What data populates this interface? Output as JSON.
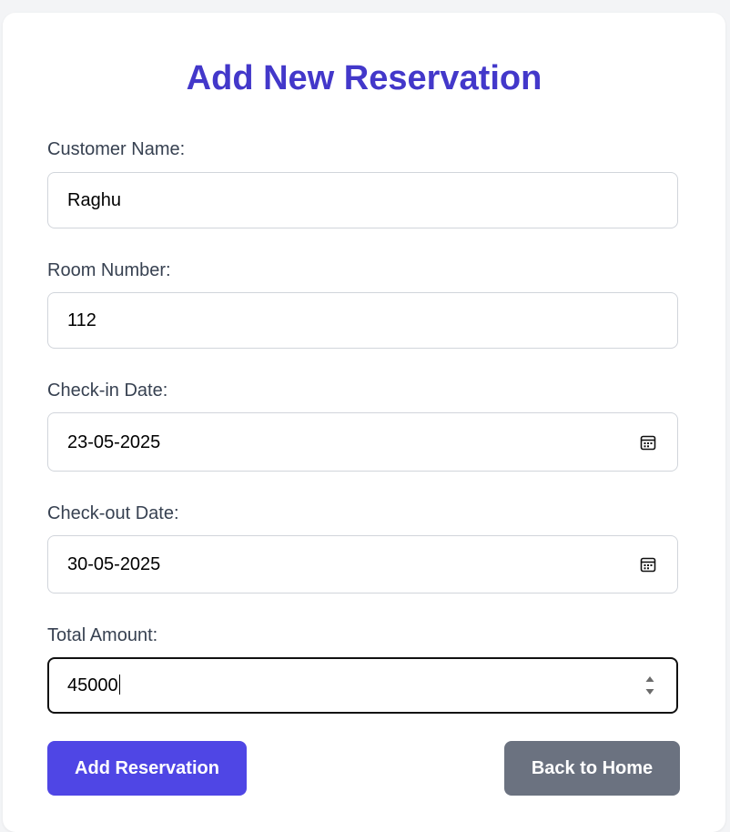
{
  "form": {
    "title": "Add New Reservation",
    "fields": {
      "customer_name": {
        "label": "Customer Name:",
        "value": "Raghu"
      },
      "room_number": {
        "label": "Room Number:",
        "value": "112"
      },
      "check_in": {
        "label": "Check-in Date:",
        "value": "23-05-2025",
        "icon": "calendar-icon"
      },
      "check_out": {
        "label": "Check-out Date:",
        "value": "30-05-2025",
        "icon": "calendar-icon"
      },
      "total_amount": {
        "label": "Total Amount:",
        "value": "45000",
        "icon": "number-spinner-icon"
      }
    },
    "buttons": {
      "add_label": "Add Reservation",
      "back_label": "Back to Home"
    }
  },
  "colors": {
    "title": "#4338ca",
    "primary_button": "#4f46e5",
    "secondary_button": "#6b7280",
    "page_background": "#f3f4f6"
  }
}
